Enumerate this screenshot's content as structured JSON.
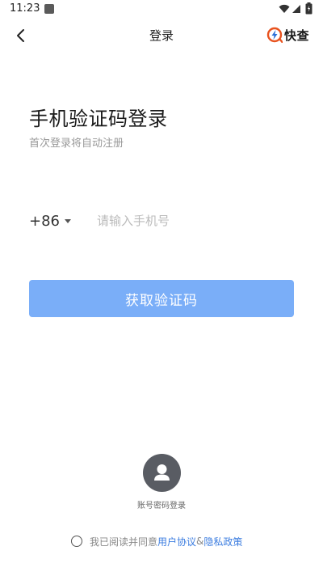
{
  "status_bar": {
    "time": "11:23",
    "icons": [
      "app-notification-icon",
      "wifi-icon",
      "signal-icon",
      "battery-icon"
    ]
  },
  "nav": {
    "title": "登录",
    "back_icon": "chevron-left-icon",
    "brand_name": "快查",
    "brand_icon": "lightning-icon"
  },
  "heading": {
    "title": "手机验证码登录",
    "subtitle": "首次登录将自动注册"
  },
  "phone": {
    "country_code": "+86",
    "input_value": "",
    "placeholder": "请输入手机号"
  },
  "get_code_button": {
    "label": "获取验证码"
  },
  "account_login": {
    "label": "账号密码登录"
  },
  "agreement": {
    "prefix": "我已阅读并同意",
    "user_agreement": "用户协议",
    "amp": "&",
    "privacy_policy": "隐私政策",
    "checked": false
  },
  "colors": {
    "button_bg": "#7aaef8",
    "link": "#3c7de0",
    "brand_accent": "#e8531f",
    "avatar_bg": "#595c63"
  }
}
